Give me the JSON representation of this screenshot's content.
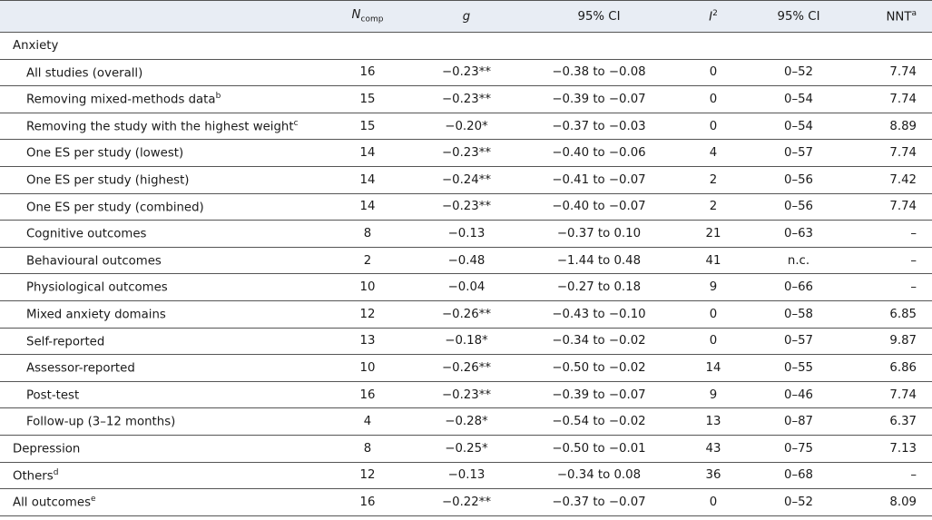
{
  "header": {
    "n_label": "N",
    "n_sub": "comp",
    "g_label": "g",
    "ci_label": "95% CI",
    "i2_label": "I",
    "i2_sup": "2",
    "ci2_label": "95% CI",
    "nnt_label": "NNT",
    "nnt_sup": "a"
  },
  "anxiety_label": "Anxiety",
  "rows": [
    {
      "label": "All studies (overall)",
      "sup": "",
      "n": "16",
      "g": "−0.23**",
      "ci": "−0.38 to −0.08",
      "i2": "0",
      "ci2": "0–52",
      "nnt": "7.74"
    },
    {
      "label": "Removing mixed-methods data",
      "sup": "b",
      "n": "15",
      "g": "−0.23**",
      "ci": "−0.39 to −0.07",
      "i2": "0",
      "ci2": "0–54",
      "nnt": "7.74"
    },
    {
      "label": "Removing the study with the highest weight",
      "sup": "c",
      "n": "15",
      "g": "−0.20*",
      "ci": "−0.37 to −0.03",
      "i2": "0",
      "ci2": "0–54",
      "nnt": "8.89"
    },
    {
      "label": "One ES per study (lowest)",
      "sup": "",
      "n": "14",
      "g": "−0.23**",
      "ci": "−0.40 to −0.06",
      "i2": "4",
      "ci2": "0–57",
      "nnt": "7.74"
    },
    {
      "label": "One ES per study (highest)",
      "sup": "",
      "n": "14",
      "g": "−0.24**",
      "ci": "−0.41 to −0.07",
      "i2": "2",
      "ci2": "0–56",
      "nnt": "7.42"
    },
    {
      "label": "One ES per study (combined)",
      "sup": "",
      "n": "14",
      "g": "−0.23**",
      "ci": "−0.40 to −0.07",
      "i2": "2",
      "ci2": "0–56",
      "nnt": "7.74"
    },
    {
      "label": "Cognitive outcomes",
      "sup": "",
      "n": "8",
      "g": "−0.13",
      "ci": "−0.37 to 0.10",
      "i2": "21",
      "ci2": "0–63",
      "nnt": "–"
    },
    {
      "label": "Behavioural outcomes",
      "sup": "",
      "n": "2",
      "g": "−0.48",
      "ci": "−1.44 to 0.48",
      "i2": "41",
      "ci2": "n.c.",
      "nnt": "–"
    },
    {
      "label": "Physiological outcomes",
      "sup": "",
      "n": "10",
      "g": "−0.04",
      "ci": "−0.27 to 0.18",
      "i2": "9",
      "ci2": "0–66",
      "nnt": "–"
    },
    {
      "label": "Mixed anxiety domains",
      "sup": "",
      "n": "12",
      "g": "−0.26**",
      "ci": "−0.43 to −0.10",
      "i2": "0",
      "ci2": "0–58",
      "nnt": "6.85"
    },
    {
      "label": "Self-reported",
      "sup": "",
      "n": "13",
      "g": "−0.18*",
      "ci": "−0.34 to −0.02",
      "i2": "0",
      "ci2": "0–57",
      "nnt": "9.87"
    },
    {
      "label": "Assessor-reported",
      "sup": "",
      "n": "10",
      "g": "−0.26**",
      "ci": "−0.50 to −0.02",
      "i2": "14",
      "ci2": "0–55",
      "nnt": "6.86"
    },
    {
      "label": "Post-test",
      "sup": "",
      "n": "16",
      "g": "−0.23**",
      "ci": "−0.39 to −0.07",
      "i2": "9",
      "ci2": "0–46",
      "nnt": "7.74"
    },
    {
      "label": "Follow-up (3–12 months)",
      "sup": "",
      "n": "4",
      "g": "−0.28*",
      "ci": "−0.54 to −0.02",
      "i2": "13",
      "ci2": "0–87",
      "nnt": "6.37"
    }
  ],
  "top_rows": [
    {
      "label": "Depression",
      "sup": "",
      "n": "8",
      "g": "−0.25*",
      "ci": "−0.50 to −0.01",
      "i2": "43",
      "ci2": "0–75",
      "nnt": "7.13"
    },
    {
      "label": "Others",
      "sup": "d",
      "n": "12",
      "g": "−0.13",
      "ci": "−0.34 to 0.08",
      "i2": "36",
      "ci2": "0–68",
      "nnt": "–"
    },
    {
      "label": "All outcomes",
      "sup": "e",
      "n": "16",
      "g": "−0.22**",
      "ci": "−0.37 to −0.07",
      "i2": "0",
      "ci2": "0–52",
      "nnt": "8.09"
    }
  ]
}
